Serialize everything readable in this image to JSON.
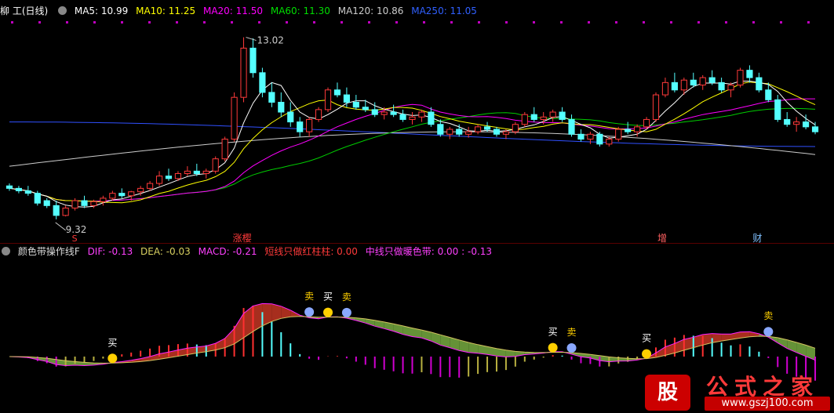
{
  "main_header": {
    "title": "柳  工(日线)",
    "ma5": "MA5: 10.99",
    "ma10": "MA10: 11.25",
    "ma20": "MA20: 11.50",
    "ma60": "MA60: 11.30",
    "ma120": "MA120: 10.86",
    "ma250": "MA250: 11.05"
  },
  "sub_header": {
    "title": "颜色带操作线F",
    "dif": "DIF: -0.13",
    "dea": "DEA: -0.03",
    "macd": "MACD: -0.21",
    "short_line": "短线只做红柱柱: 0.00",
    "mid_line": "中线只做暖色带: 0.00 : -0.13"
  },
  "annotations": {
    "high": "13.02",
    "low": "9.32",
    "s_mark": "S",
    "zhangting": "涨樱",
    "zeng": "增",
    "cai": "财"
  },
  "signals": {
    "sell": "卖",
    "buy": "买"
  },
  "watermark": {
    "text": "公式之家",
    "url": "www.gszj100.com",
    "badge": "股"
  },
  "colors": {
    "ma5": "#ffffff",
    "ma10": "#ffff00",
    "ma20": "#ff00ff",
    "ma60": "#00cc00",
    "ma120": "#cccccc",
    "ma250": "#3050ff",
    "up": "#ff3a3a",
    "down": "#54ffff",
    "dif": "#ff22ff",
    "dea": "#d4c560",
    "red_band": "#b03020",
    "green_band": "#6a9a3a"
  },
  "chart_data": {
    "type": "candlestick",
    "title": "柳  工(日线)",
    "price_range": [
      9.32,
      13.02
    ],
    "candles": [
      [
        10.0,
        10.05,
        9.9,
        9.95
      ],
      [
        9.95,
        10.0,
        9.85,
        9.9
      ],
      [
        9.9,
        10.0,
        9.8,
        9.85
      ],
      [
        9.85,
        9.9,
        9.6,
        9.65
      ],
      [
        9.7,
        9.75,
        9.55,
        9.6
      ],
      [
        9.6,
        9.7,
        9.32,
        9.4
      ],
      [
        9.4,
        9.6,
        9.38,
        9.55
      ],
      [
        9.55,
        9.75,
        9.5,
        9.7
      ],
      [
        9.7,
        9.8,
        9.55,
        9.6
      ],
      [
        9.6,
        9.72,
        9.55,
        9.68
      ],
      [
        9.68,
        9.8,
        9.6,
        9.75
      ],
      [
        9.75,
        9.9,
        9.7,
        9.85
      ],
      [
        9.85,
        9.95,
        9.75,
        9.8
      ],
      [
        9.8,
        9.9,
        9.7,
        9.88
      ],
      [
        9.88,
        10.0,
        9.8,
        9.95
      ],
      [
        9.95,
        10.1,
        9.9,
        10.05
      ],
      [
        10.05,
        10.3,
        10.0,
        10.2
      ],
      [
        10.2,
        10.35,
        10.1,
        10.15
      ],
      [
        10.15,
        10.3,
        10.1,
        10.25
      ],
      [
        10.25,
        10.4,
        10.2,
        10.3
      ],
      [
        10.3,
        10.45,
        10.2,
        10.25
      ],
      [
        10.25,
        10.35,
        10.15,
        10.3
      ],
      [
        10.3,
        10.6,
        10.25,
        10.55
      ],
      [
        10.55,
        11.0,
        10.5,
        10.95
      ],
      [
        10.95,
        11.9,
        10.9,
        11.8
      ],
      [
        11.8,
        13.02,
        11.7,
        12.8
      ],
      [
        12.8,
        13.0,
        12.2,
        12.3
      ],
      [
        12.3,
        12.4,
        11.8,
        11.9
      ],
      [
        11.9,
        12.1,
        11.6,
        11.7
      ],
      [
        11.7,
        11.9,
        11.4,
        11.5
      ],
      [
        11.5,
        11.7,
        11.2,
        11.3
      ],
      [
        11.3,
        11.4,
        11.0,
        11.1
      ],
      [
        11.1,
        11.4,
        11.0,
        11.35
      ],
      [
        11.35,
        11.6,
        11.3,
        11.55
      ],
      [
        11.55,
        12.0,
        11.5,
        11.95
      ],
      [
        11.95,
        12.1,
        11.8,
        11.85
      ],
      [
        11.85,
        12.0,
        11.6,
        11.7
      ],
      [
        11.7,
        11.85,
        11.55,
        11.6
      ],
      [
        11.6,
        11.75,
        11.5,
        11.55
      ],
      [
        11.55,
        11.7,
        11.4,
        11.45
      ],
      [
        11.45,
        11.6,
        11.35,
        11.5
      ],
      [
        11.5,
        11.65,
        11.4,
        11.45
      ],
      [
        11.45,
        11.55,
        11.3,
        11.35
      ],
      [
        11.35,
        11.5,
        11.25,
        11.4
      ],
      [
        11.4,
        11.55,
        11.3,
        11.5
      ],
      [
        11.5,
        11.6,
        11.2,
        11.25
      ],
      [
        11.25,
        11.35,
        11.0,
        11.05
      ],
      [
        11.05,
        11.2,
        10.95,
        11.15
      ],
      [
        11.15,
        11.25,
        11.0,
        11.05
      ],
      [
        11.05,
        11.2,
        10.98,
        11.1
      ],
      [
        11.1,
        11.25,
        11.05,
        11.2
      ],
      [
        11.2,
        11.3,
        11.1,
        11.15
      ],
      [
        11.15,
        11.2,
        11.0,
        11.05
      ],
      [
        11.05,
        11.15,
        10.95,
        11.1
      ],
      [
        11.1,
        11.3,
        11.05,
        11.25
      ],
      [
        11.25,
        11.5,
        11.2,
        11.45
      ],
      [
        11.45,
        11.6,
        11.3,
        11.35
      ],
      [
        11.35,
        11.5,
        11.25,
        11.4
      ],
      [
        11.4,
        11.55,
        11.3,
        11.5
      ],
      [
        11.5,
        11.6,
        11.3,
        11.35
      ],
      [
        11.35,
        11.45,
        11.0,
        11.05
      ],
      [
        11.05,
        11.15,
        10.9,
        10.95
      ],
      [
        10.95,
        11.1,
        10.85,
        11.05
      ],
      [
        11.05,
        11.1,
        10.8,
        10.85
      ],
      [
        10.85,
        11.0,
        10.8,
        10.95
      ],
      [
        10.95,
        11.2,
        10.9,
        11.15
      ],
      [
        11.15,
        11.3,
        11.05,
        11.1
      ],
      [
        11.1,
        11.25,
        11.0,
        11.2
      ],
      [
        11.2,
        11.4,
        11.15,
        11.35
      ],
      [
        11.35,
        11.9,
        11.3,
        11.85
      ],
      [
        11.85,
        12.2,
        11.8,
        12.1
      ],
      [
        12.1,
        12.3,
        11.9,
        11.95
      ],
      [
        11.95,
        12.2,
        11.85,
        12.15
      ],
      [
        12.15,
        12.3,
        12.0,
        12.05
      ],
      [
        12.05,
        12.25,
        11.95,
        12.2
      ],
      [
        12.2,
        12.35,
        12.05,
        12.1
      ],
      [
        12.1,
        12.2,
        11.9,
        11.95
      ],
      [
        11.95,
        12.1,
        11.8,
        12.05
      ],
      [
        12.05,
        12.4,
        12.0,
        12.35
      ],
      [
        12.35,
        12.45,
        12.1,
        12.2
      ],
      [
        12.2,
        12.3,
        11.9,
        11.95
      ],
      [
        11.95,
        12.1,
        11.7,
        11.75
      ],
      [
        11.75,
        11.85,
        11.3,
        11.35
      ],
      [
        11.35,
        11.5,
        11.2,
        11.25
      ],
      [
        11.25,
        11.4,
        11.1,
        11.3
      ],
      [
        11.3,
        11.45,
        11.15,
        11.2
      ],
      [
        11.2,
        11.3,
        11.05,
        11.1
      ]
    ],
    "indicator": {
      "dif_last": -0.13,
      "dea_last": -0.03,
      "macd_last": -0.21
    }
  }
}
